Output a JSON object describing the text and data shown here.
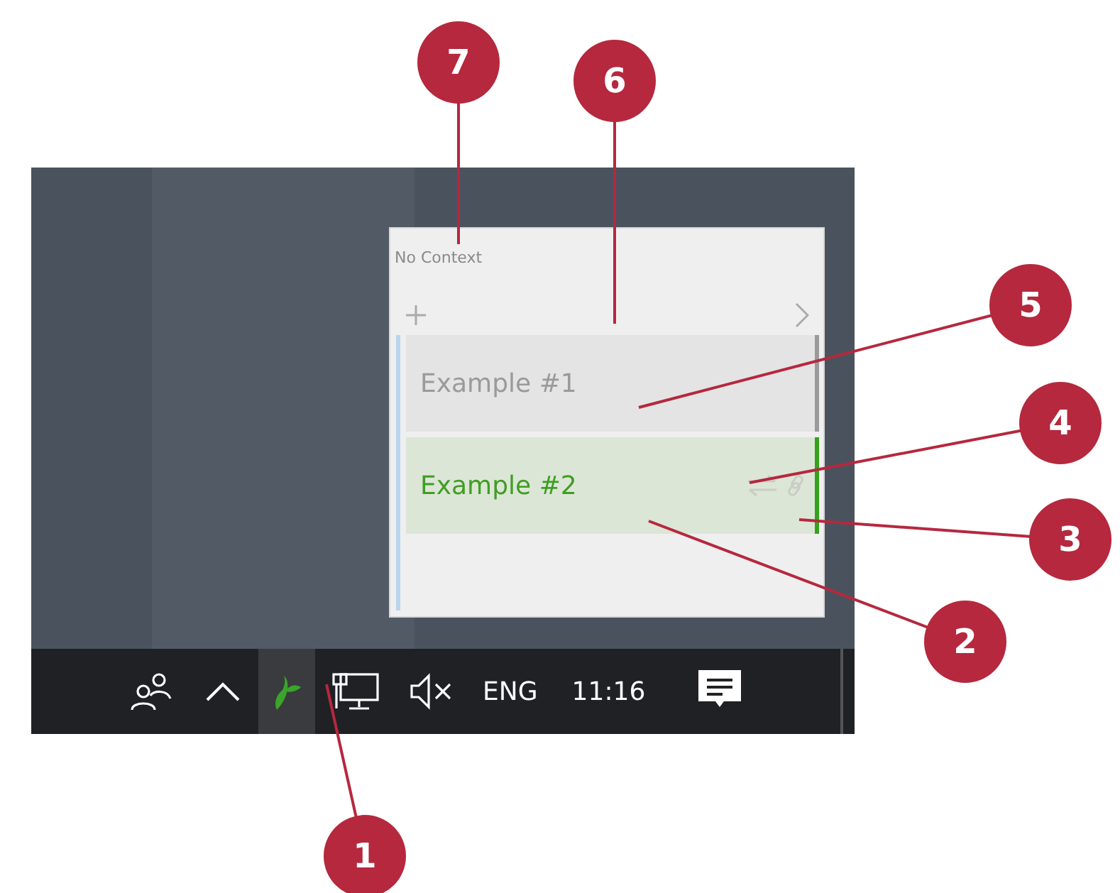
{
  "popup": {
    "context": "No Context",
    "items": [
      {
        "label": "Example #1",
        "selected": false,
        "linked": false
      },
      {
        "label": "Example #2",
        "selected": true,
        "linked": true
      }
    ]
  },
  "taskbar": {
    "language": "ENG",
    "time": "11:16"
  },
  "callouts": [
    {
      "number": "7"
    },
    {
      "number": "6"
    },
    {
      "number": "5"
    },
    {
      "number": "4"
    },
    {
      "number": "3"
    },
    {
      "number": "2"
    },
    {
      "number": "1"
    }
  ]
}
